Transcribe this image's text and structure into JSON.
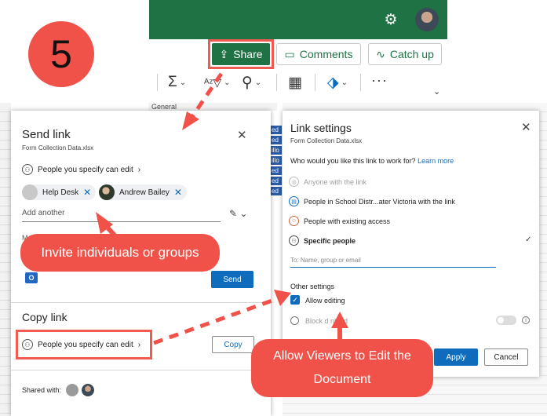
{
  "step_number": "5",
  "ribbon": {
    "share_label": "Share",
    "comments_label": "Comments",
    "catchup_label": "Catch up",
    "more_label": "···",
    "column_label": "General"
  },
  "sheet": {
    "cell_fragments": [
      "ed",
      "ed",
      "illo",
      "illo",
      "ed",
      "ed",
      "ed"
    ]
  },
  "send_link": {
    "title": "Send link",
    "file_name": "Form Collection Data.xlsx",
    "permission": "People you specify can edit",
    "recipients": [
      {
        "name": "Help Desk"
      },
      {
        "name": "Andrew Bailey"
      }
    ],
    "add_placeholder": "Add another",
    "message_fragment": "M",
    "outlook_glyph": "O",
    "send_label": "Send",
    "copy_title": "Copy link",
    "copy_permission": "People you specify can edit",
    "copy_label": "Copy",
    "shared_with_label": "Shared with:"
  },
  "link_settings": {
    "title": "Link settings",
    "file_name": "Form Collection Data.xlsx",
    "question": "Who would you like this link to work for?",
    "learn_more": "Learn more",
    "options": [
      {
        "label": "Anyone with the link",
        "disabled": true
      },
      {
        "label": "People in School Distr...ater Victoria with the link",
        "disabled": false
      },
      {
        "label": "People with existing access",
        "disabled": false
      },
      {
        "label": "Specific people",
        "selected": true
      }
    ],
    "to_placeholder": "To: Name, group or email",
    "other_settings": "Other settings",
    "allow_editing": "Allow editing",
    "allow_editing_checked": true,
    "block_download": "Block d   nload",
    "apply_label": "Apply",
    "cancel_label": "Cancel"
  },
  "callouts": {
    "invite": "Invite individuals or groups",
    "allow_line1": "Allow Viewers to Edit the",
    "allow_line2": "Document"
  },
  "colors": {
    "excel_green": "#1f7244",
    "accent_blue": "#0f6cbd",
    "callout_red": "#f0524a"
  }
}
